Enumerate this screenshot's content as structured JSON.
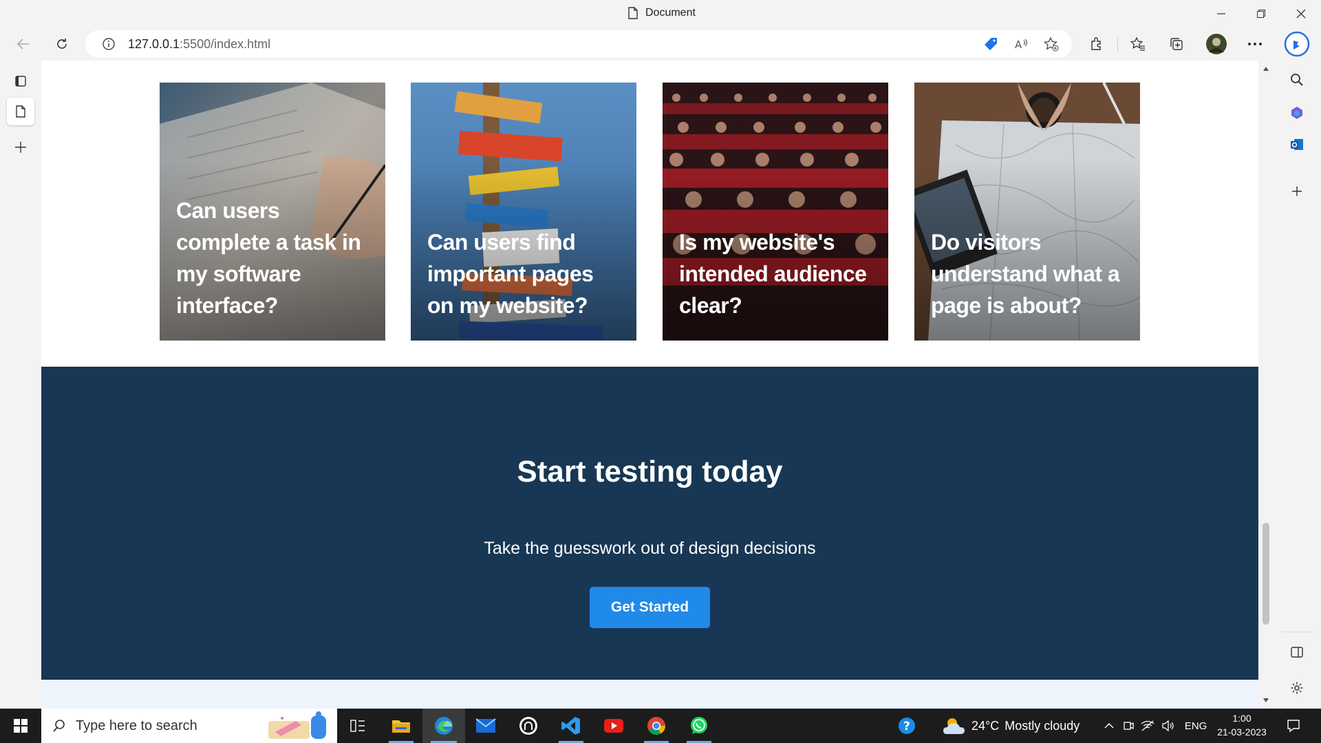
{
  "window": {
    "title": "Document"
  },
  "browser": {
    "url_host": "127.0.0.1",
    "url_rest": ":5500/index.html"
  },
  "cards": [
    {
      "text": "Can users complete a task in my software interface?"
    },
    {
      "text": "Can users find important pages on my website?"
    },
    {
      "text": "Is my website's intended audience clear?"
    },
    {
      "text": "Do visitors understand what a page is about?"
    }
  ],
  "cta": {
    "title": "Start testing today",
    "subtitle": "Take the guesswork out of design decisions",
    "button": "Get Started"
  },
  "taskbar": {
    "search_placeholder": "Type here to search",
    "weather_temp": "24°C",
    "weather_desc": "Mostly cloudy",
    "language": "ENG",
    "time": "1:00",
    "date": "21-03-2023"
  },
  "colors": {
    "cta_bg": "#183754",
    "cta_button": "#1f8ae8"
  }
}
